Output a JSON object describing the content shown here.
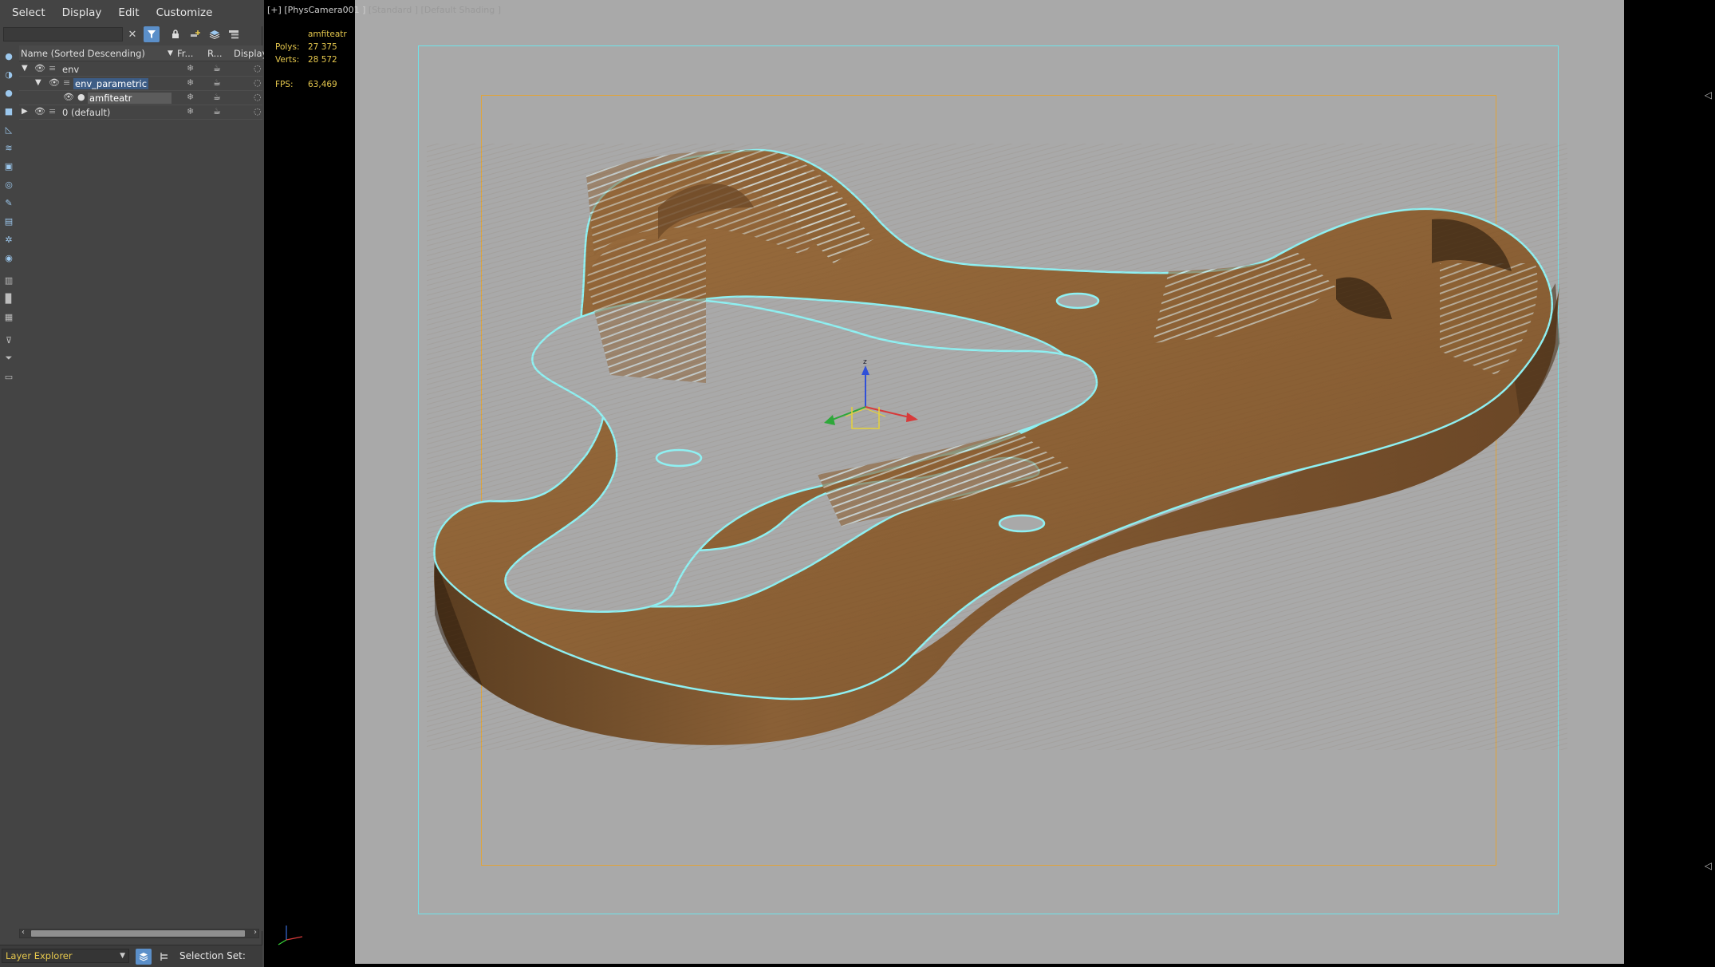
{
  "menu": [
    "Select",
    "Display",
    "Edit",
    "Customize"
  ],
  "explorer": {
    "columns": {
      "name": "Name (Sorted Descending)",
      "frozen": "Fr...",
      "render": "R...",
      "display": "Display"
    },
    "rows": [
      {
        "label": "env"
      },
      {
        "label": "env_parametric"
      },
      {
        "label": "amfiteatr"
      },
      {
        "label": "0 (default)"
      }
    ]
  },
  "bottom": {
    "layer_explorer": "Layer Explorer",
    "selection_set": "Selection Set:"
  },
  "viewport": {
    "label_plus": "[+]",
    "label_camera": "[PhysCamera001 ]",
    "label_standard": "[Standard ]",
    "label_shading": "[Default Shading ]",
    "stats": {
      "object": "amfiteatr",
      "polys_label": "Polys:",
      "polys_value": "27 375",
      "verts_label": "Verts:",
      "verts_value": "28 572",
      "fps_label": "FPS:",
      "fps_value": "63,469"
    },
    "gizmo_axis": "z"
  },
  "icons": {
    "search_clear": "close-icon",
    "filter": "filter-icon",
    "lock": "lock-icon",
    "add_layer": "add-layer-icon",
    "layers": "layers-icon",
    "hierarchy": "hierarchy-icon"
  },
  "colors": {
    "viewport_bg": "#a9a9a9",
    "safe_frame": "#6fe3ea",
    "render_frame": "#e0a43a",
    "selection_outline": "#8ff0f2",
    "wood": "#8f6338",
    "stat_text": "#e6c84d",
    "active_button": "#5b8fc9"
  }
}
